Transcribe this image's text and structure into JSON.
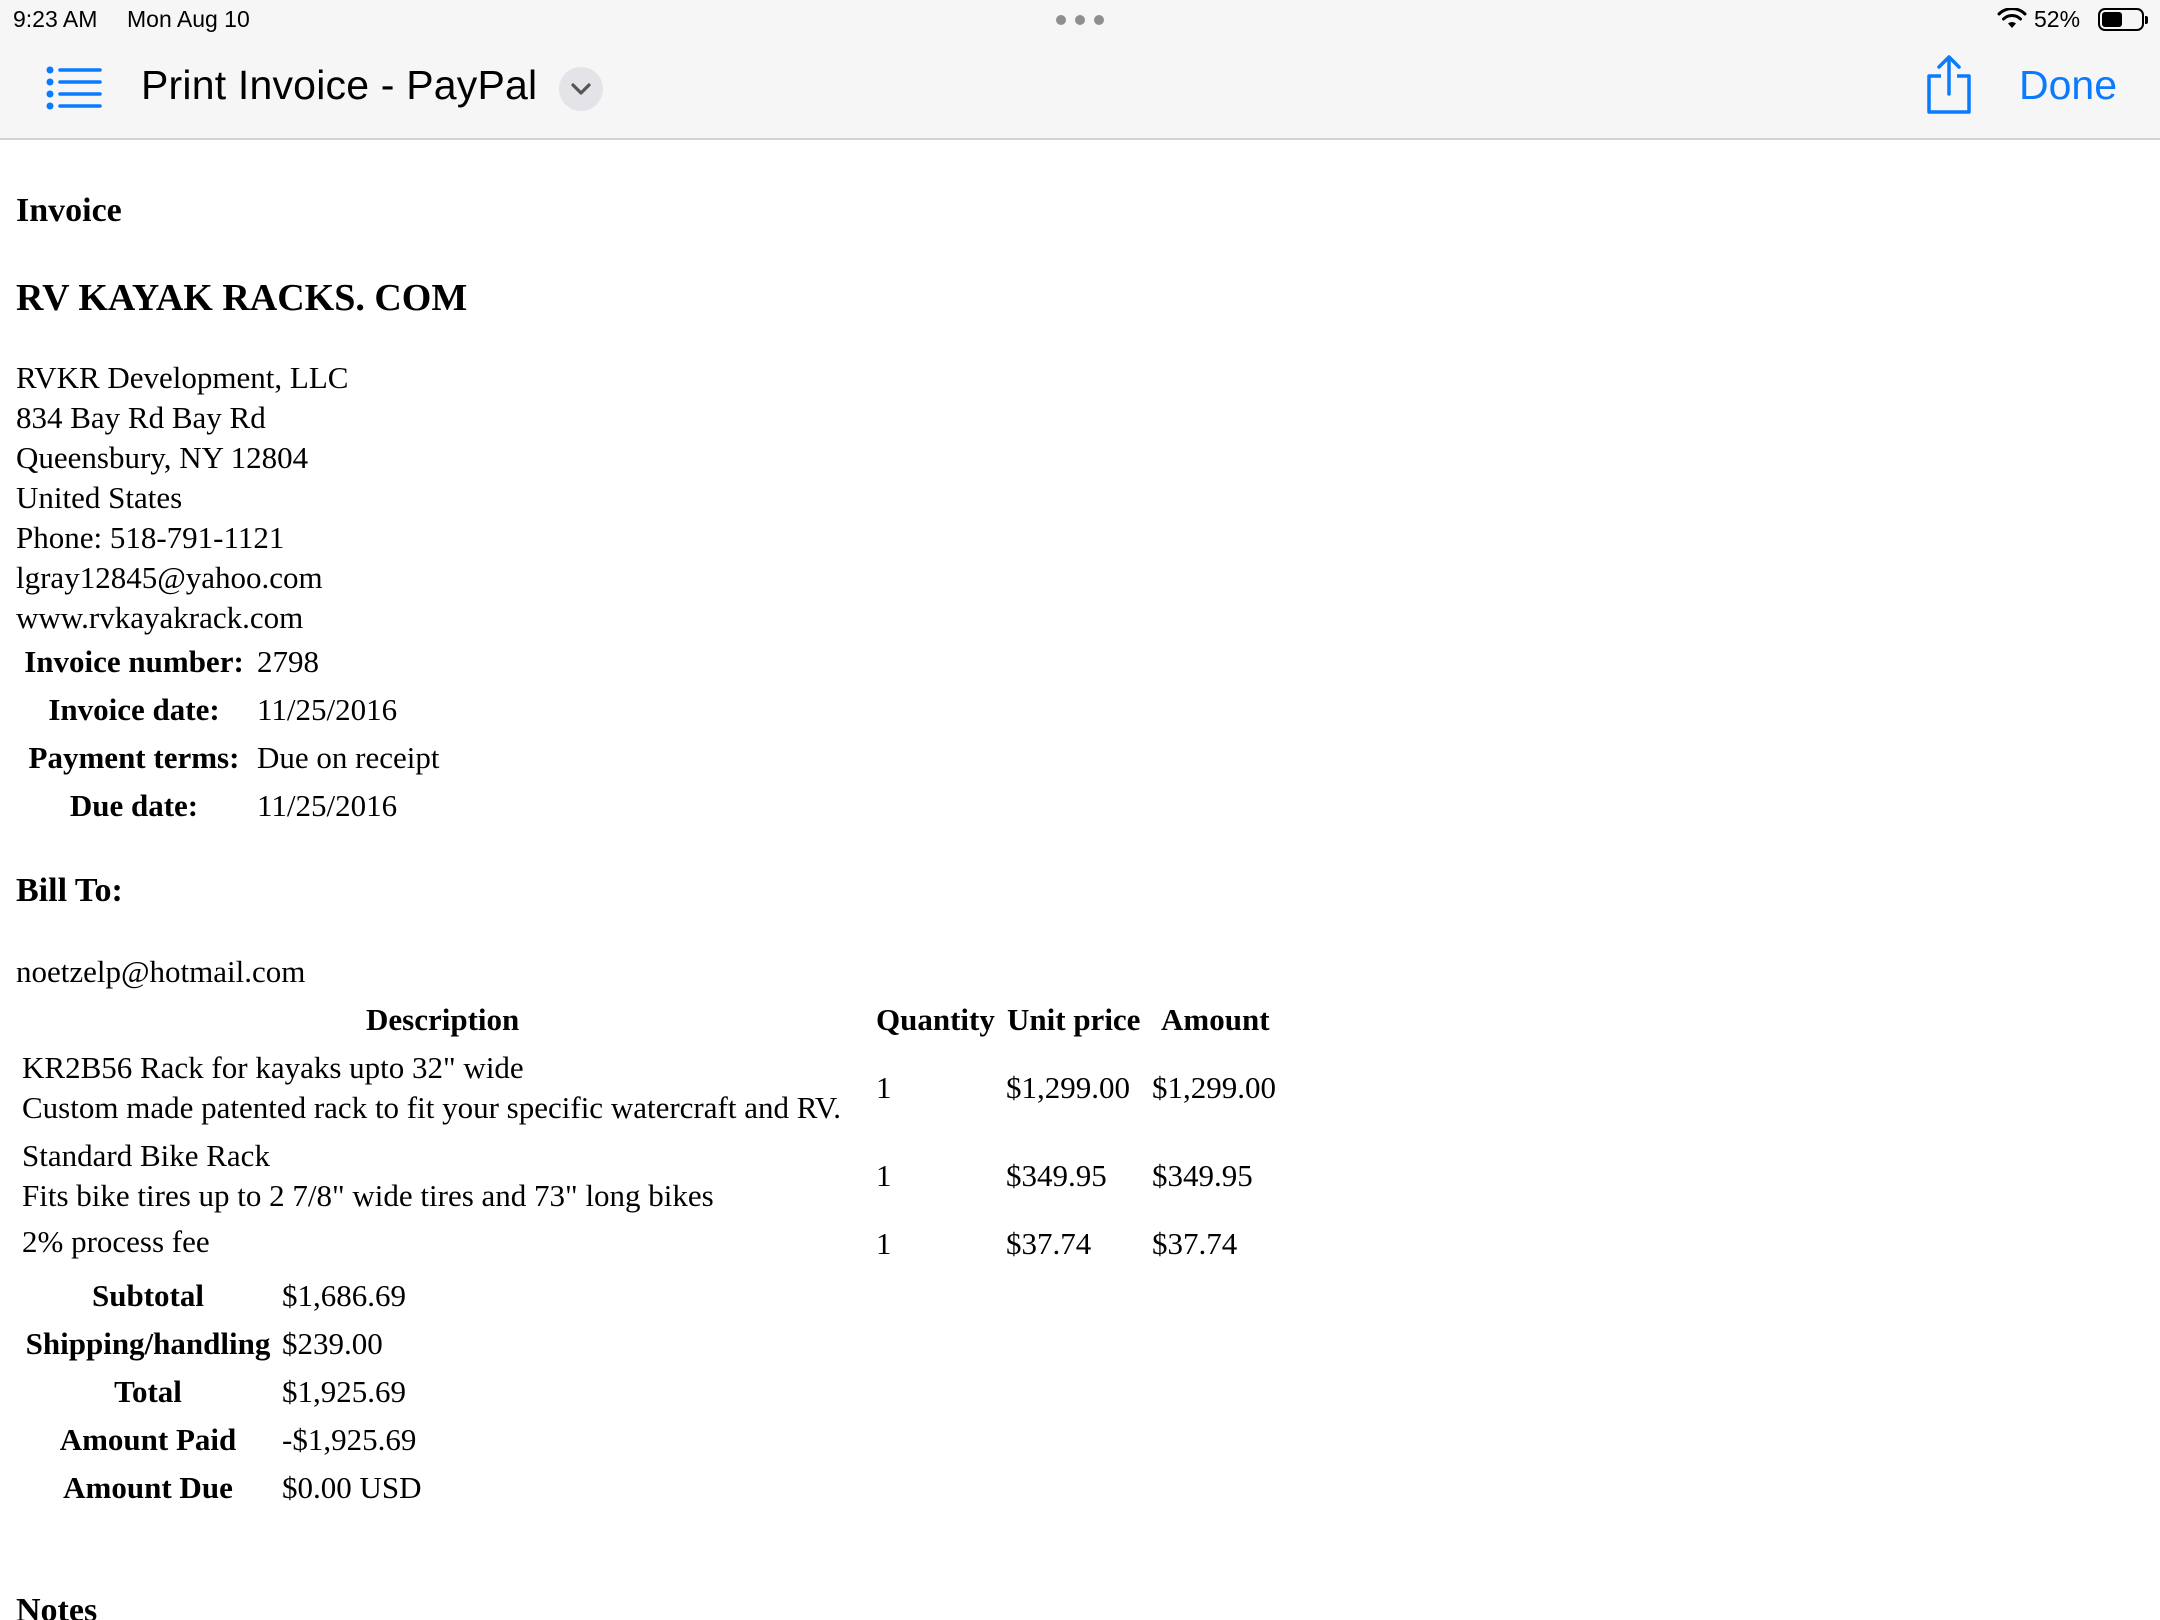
{
  "status_bar": {
    "time": "9:23 AM",
    "date": "Mon Aug 10",
    "battery_percent": "52%",
    "battery_level": 0.52
  },
  "toolbar": {
    "title": "Print Invoice - PayPal",
    "done_label": "Done",
    "icons": [
      "list-icon",
      "chevron-down-icon",
      "share-icon"
    ],
    "accent_color": "#0a7aff"
  },
  "invoice": {
    "heading": "Invoice",
    "company": "RV KAYAK RACKS. COM",
    "address_lines": [
      "RVKR Development, LLC",
      "834 Bay Rd Bay Rd",
      "Queensbury, NY 12804",
      "United States",
      "Phone: 518-791-1121",
      "lgray12845@yahoo.com",
      "www.rvkayakrack.com"
    ],
    "meta": [
      {
        "label": "Invoice number:",
        "value": "2798"
      },
      {
        "label": "Invoice date:",
        "value": "11/25/2016"
      },
      {
        "label": "Payment terms:",
        "value": "Due on receipt"
      },
      {
        "label": "Due date:",
        "value": "11/25/2016"
      }
    ],
    "bill_to_heading": "Bill To:",
    "bill_to": "noetzelp@hotmail.com",
    "table": {
      "headers": {
        "description": "Description",
        "quantity": "Quantity",
        "unit_price": "Unit price",
        "amount": "Amount"
      },
      "rows": [
        {
          "name": "KR2B56 Rack for kayaks upto 32\" wide",
          "detail": "Custom made patented rack to fit your specific watercraft and RV.",
          "quantity": "1",
          "unit_price": "$1,299.00",
          "amount": "$1,299.00"
        },
        {
          "name": "Standard Bike Rack",
          "detail": "Fits bike tires up to 2 7/8\" wide tires and 73\" long bikes",
          "quantity": "1",
          "unit_price": "$349.95",
          "amount": "$349.95"
        },
        {
          "name": "2% process fee",
          "detail": "",
          "quantity": "1",
          "unit_price": "$37.74",
          "amount": "$37.74"
        }
      ]
    },
    "totals": [
      {
        "label": "Subtotal",
        "value": "$1,686.69"
      },
      {
        "label": "Shipping/handling",
        "value": "$239.00"
      },
      {
        "label": "Total",
        "value": "$1,925.69"
      },
      {
        "label": "Amount Paid",
        "value": "-$1,925.69"
      },
      {
        "label": "Amount Due",
        "value": "$0.00 USD"
      }
    ],
    "notes_heading": "Notes"
  }
}
